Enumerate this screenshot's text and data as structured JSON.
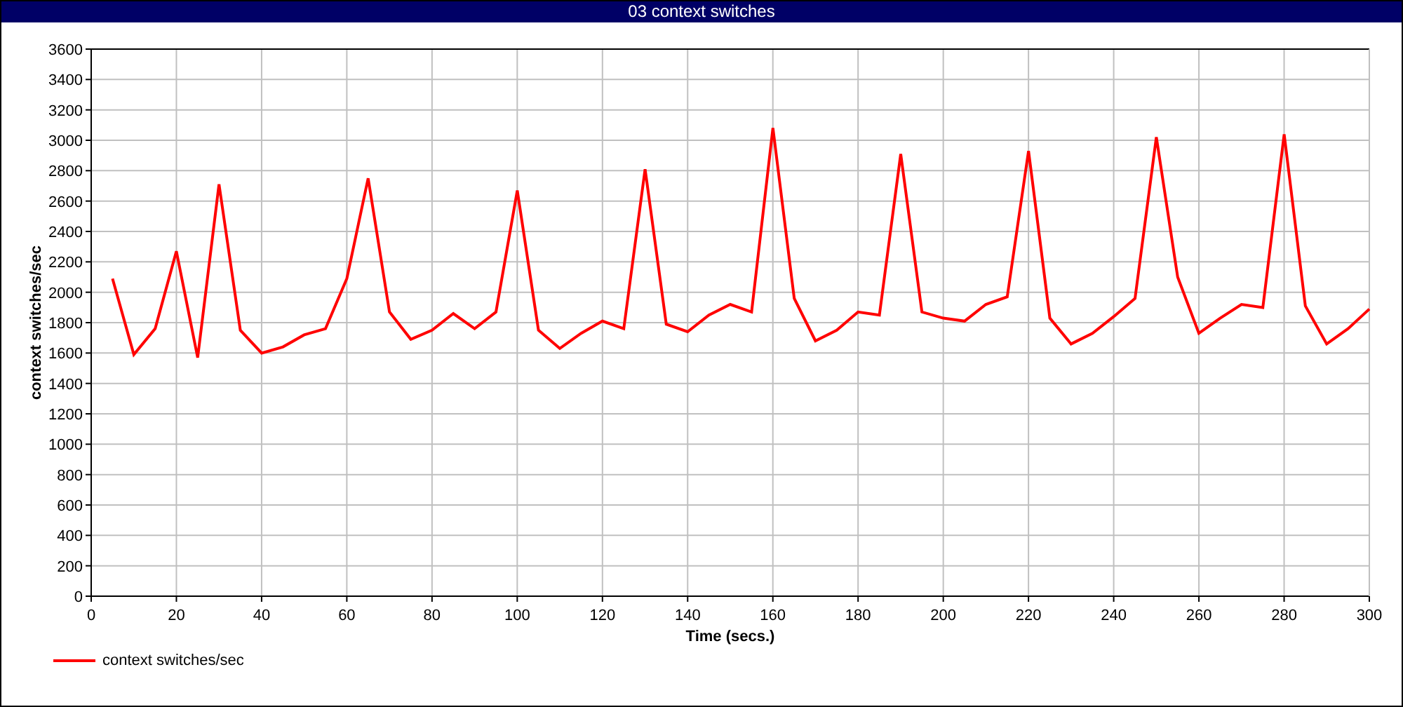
{
  "window": {
    "title": "03 context switches"
  },
  "chart_data": {
    "type": "line",
    "grid": true,
    "xlabel": "Time (secs.)",
    "ylabel": "context switches/sec",
    "xlim": [
      0,
      300
    ],
    "ylim": [
      0,
      3600
    ],
    "xticks": [
      0,
      20,
      40,
      60,
      80,
      100,
      120,
      140,
      160,
      180,
      200,
      220,
      240,
      260,
      280,
      300
    ],
    "yticks": [
      0,
      200,
      400,
      600,
      800,
      1000,
      1200,
      1400,
      1600,
      1800,
      2000,
      2200,
      2400,
      2600,
      2800,
      3000,
      3200,
      3400,
      3600
    ],
    "x": [
      5,
      10,
      15,
      20,
      25,
      30,
      35,
      40,
      45,
      50,
      55,
      60,
      65,
      70,
      75,
      80,
      85,
      90,
      95,
      100,
      105,
      110,
      115,
      120,
      125,
      130,
      135,
      140,
      145,
      150,
      155,
      160,
      165,
      170,
      175,
      180,
      185,
      190,
      195,
      200,
      205,
      210,
      215,
      220,
      225,
      230,
      235,
      240,
      245,
      250,
      255,
      260,
      265,
      270,
      275,
      280,
      285,
      290,
      295,
      300
    ],
    "series": [
      {
        "name": "context switches/sec",
        "color": "#ff0000",
        "values": [
          2090,
          1590,
          1760,
          2270,
          1570,
          2710,
          1750,
          1600,
          1640,
          1720,
          1760,
          2090,
          2750,
          1870,
          1690,
          1750,
          1860,
          1760,
          1870,
          2670,
          1750,
          1630,
          1730,
          1810,
          1760,
          2810,
          1790,
          1740,
          1850,
          1920,
          1870,
          3080,
          1960,
          1680,
          1750,
          1870,
          1850,
          2910,
          1870,
          1830,
          1810,
          1920,
          1970,
          2930,
          1830,
          1660,
          1730,
          1840,
          1960,
          3020,
          2100,
          1730,
          1830,
          1920,
          1900,
          3040,
          1910,
          1660,
          1760,
          1890
        ]
      }
    ]
  }
}
